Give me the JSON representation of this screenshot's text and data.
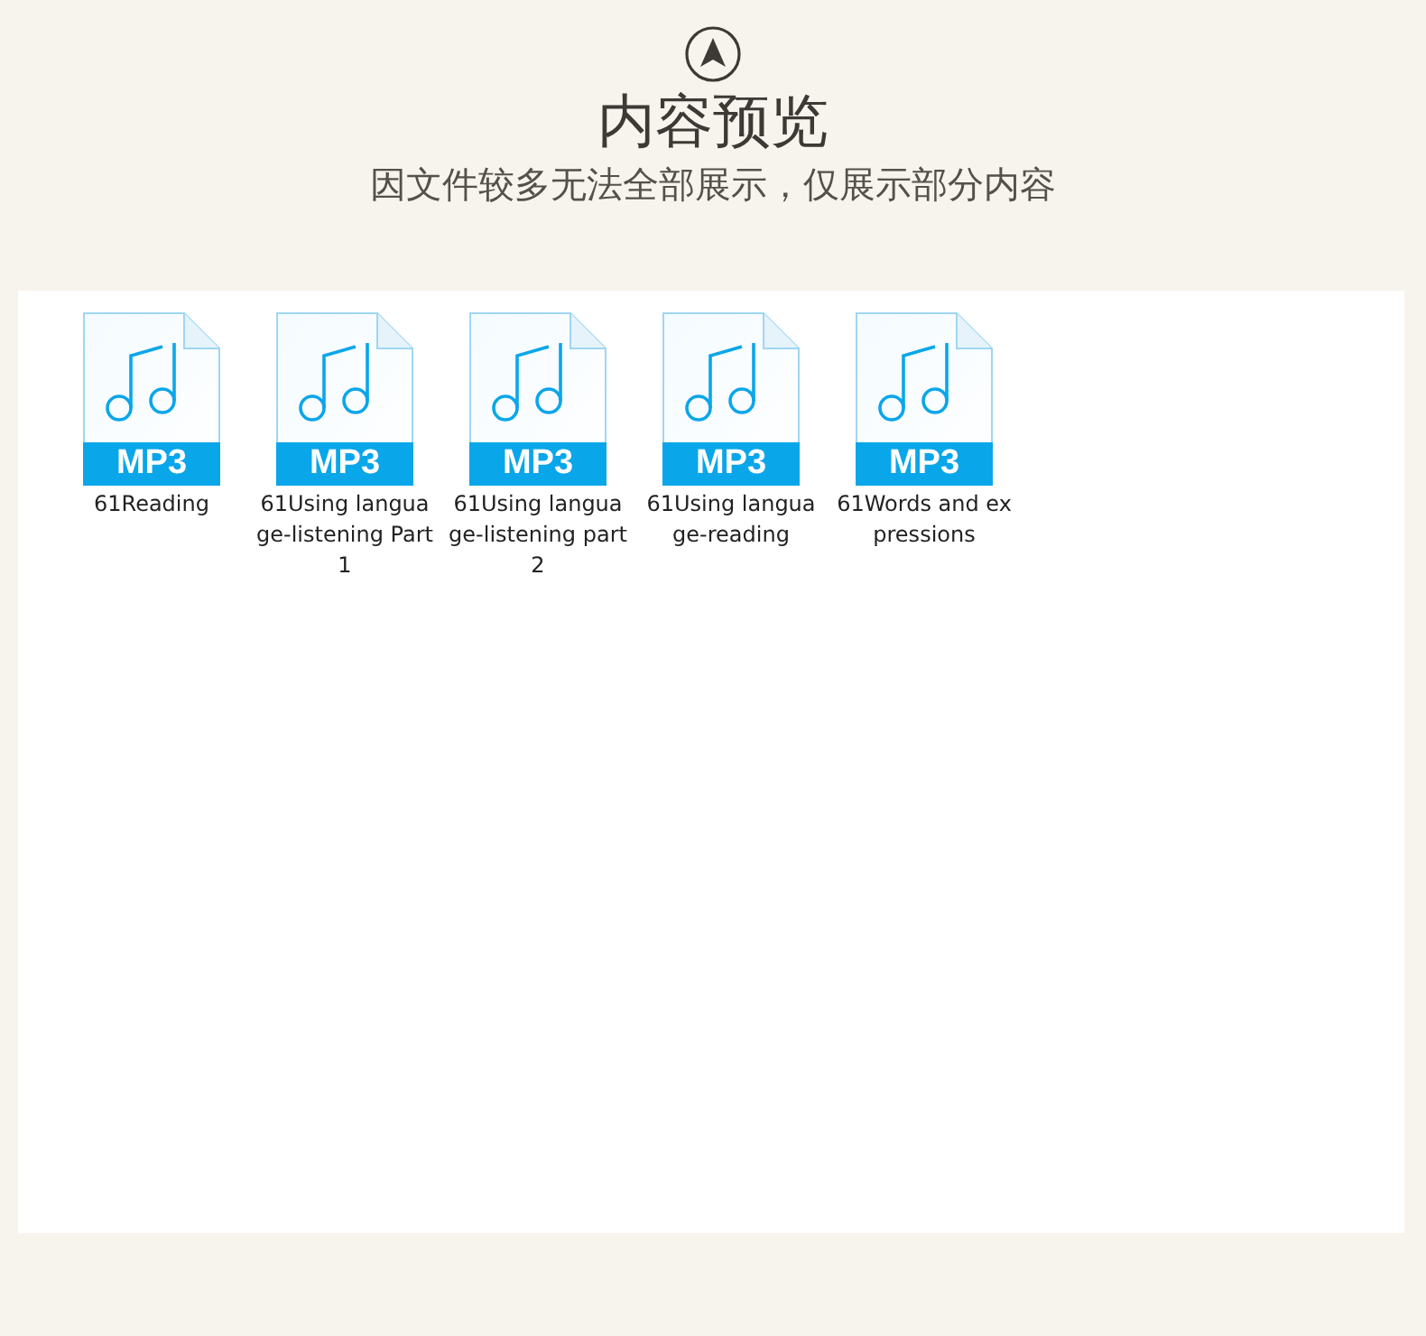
{
  "header": {
    "title": "内容预览",
    "subtitle": "因文件较多无法全部展示，仅展示部分内容"
  },
  "files": [
    {
      "name": "61Reading",
      "type": "MP3"
    },
    {
      "name": "61Using language-listening Part 1",
      "type": "MP3"
    },
    {
      "name": "61Using language-listening part2",
      "type": "MP3"
    },
    {
      "name": "61Using language-reading",
      "type": "MP3"
    },
    {
      "name": "61Words and expressions",
      "type": "MP3"
    }
  ]
}
